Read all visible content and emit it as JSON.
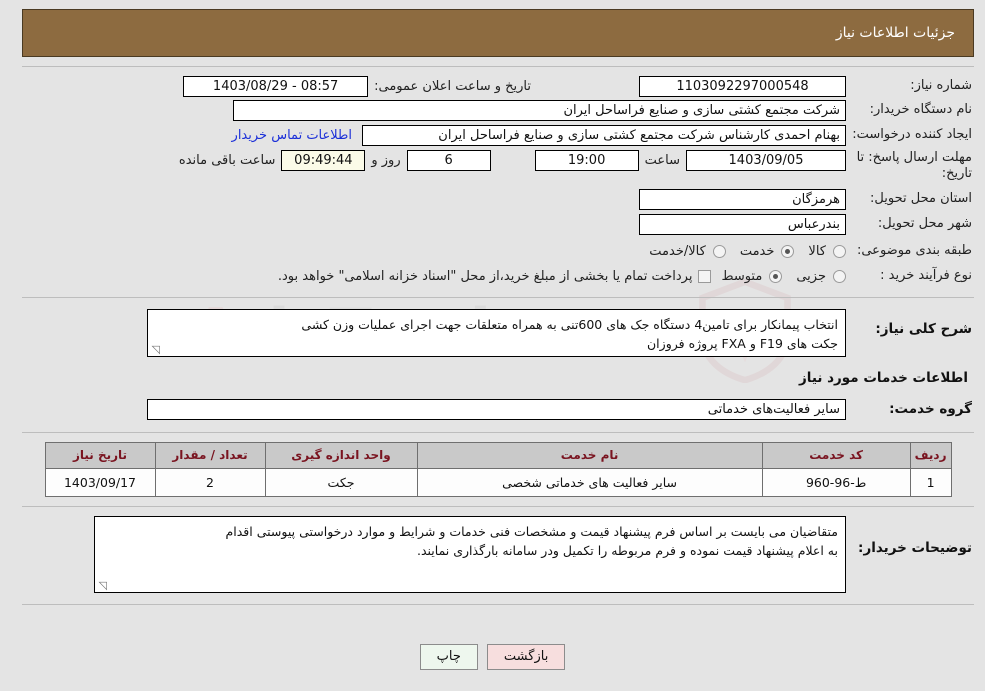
{
  "header": {
    "title": "جزئیات اطلاعات نیاز"
  },
  "colors": {
    "header_bg": "#8d6b40",
    "page_bg": "#e4e4e4",
    "link": "#1b2fd8",
    "table_header_bg": "#c9c9c9",
    "table_header_text": "#7a1420",
    "countdown_bg": "#fbfbe8",
    "print_button_bg": "#eef7ee",
    "back_button_bg": "#f7dede"
  },
  "watermark": {
    "text_left": "Ar",
    "text_mid": "ia",
    "text_right": "Tender.net"
  },
  "form": {
    "need_number_label": "شماره نیاز:",
    "need_number_value": "1103092297000548",
    "announce_date_label": "تاریخ و ساعت اعلان عمومی:",
    "announce_date_value": "08:57 - 1403/08/29",
    "buyer_org_label": "نام دستگاه خریدار:",
    "buyer_org_value": "شرکت مجتمع کشتی سازی و صنایع فراساحل ایران",
    "requester_label": "ایجاد کننده درخواست:",
    "requester_value": "بهنام احمدی کارشناس شرکت مجتمع کشتی سازی و صنایع فراساحل ایران",
    "buyer_contact_link": "اطلاعات تماس خریدار",
    "deadline_label": "مهلت ارسال پاسخ: تا تاریخ:",
    "deadline_date_value": "1403/09/05",
    "deadline_time_label": "ساعت",
    "deadline_time_value": "19:00",
    "remaining_days_value": "6",
    "remaining_days_label": "روز و",
    "remaining_time_value": "09:49:44",
    "remaining_suffix_label": "ساعت باقی مانده",
    "province_label": "استان محل تحویل:",
    "province_value": "هرمزگان",
    "city_label": "شهر محل تحویل:",
    "city_value": "بندرعباس",
    "category_label": "طبقه بندی موضوعی:",
    "category_options": [
      {
        "label": "کالا",
        "selected": false
      },
      {
        "label": "خدمت",
        "selected": true
      },
      {
        "label": "کالا/خدمت",
        "selected": false
      }
    ],
    "process_label": "نوع فرآیند خرید :",
    "process_options": [
      {
        "label": "جزیی",
        "selected": false
      },
      {
        "label": "متوسط",
        "selected": true
      }
    ],
    "treasury_checkbox_checked": false,
    "treasury_note": "پرداخت تمام یا بخشی از مبلغ خرید،از محل \"اسناد خزانه اسلامی\" خواهد بود."
  },
  "description": {
    "label": "شرح کلی نیاز:",
    "line1": "انتخاب پیمانکار برای تامین4 دستگاه جک های 600تنی  به همراه متعلقات جهت اجرای عملیات وزن کشی",
    "line2": "جکت های F19 و FXA  پروژه فروزان"
  },
  "services_section": {
    "title": "اطلاعات خدمات مورد نیاز",
    "service_group_label": "گروه خدمت:",
    "service_group_value": "سایر فعالیت‌های خدماتی"
  },
  "table": {
    "headers": [
      "ردیف",
      "کد خدمت",
      "نام خدمت",
      "واحد اندازه گیری",
      "تعداد / مقدار",
      "تاریخ نیاز"
    ],
    "rows": [
      {
        "row_no": "1",
        "service_code": "ط-96-960",
        "service_name": "سایر فعالیت های خدماتی شخصی",
        "unit": "جکت",
        "quantity": "2",
        "need_date": "1403/09/17"
      }
    ]
  },
  "buyer_notes": {
    "label": "توضیحات خریدار:",
    "line1": "متقاضیان می بایست بر اساس فرم پیشنهاد قیمت و مشخصات فنی خدمات و شرایط و موارد درخواستی پیوستی  اقدام",
    "line2": "به اعلام پیشنهاد قیمت نموده و فرم مربوطه را تکمیل ودر سامانه بارگذاری نمایند."
  },
  "buttons": {
    "print": "چاپ",
    "back": "بازگشت"
  }
}
